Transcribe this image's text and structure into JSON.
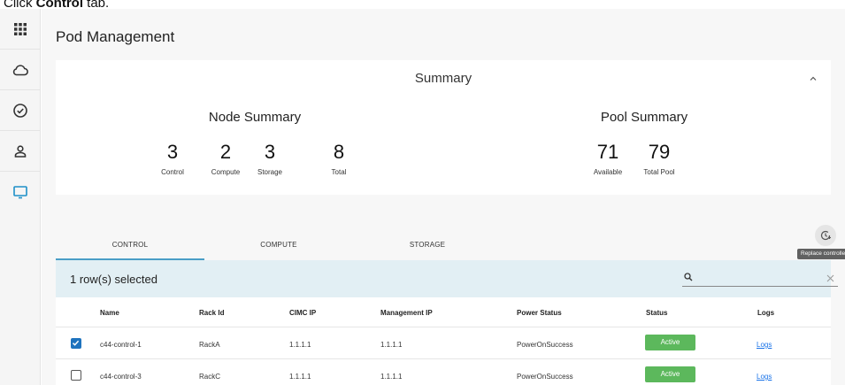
{
  "instruction": {
    "prefix": "Click ",
    "target": "Control",
    "suffix": " tab."
  },
  "sidebar": {
    "icons": [
      "grid-icon",
      "cloud-icon",
      "check-circle-icon",
      "user-icon",
      "monitor-icon"
    ]
  },
  "page_title": "Pod Management",
  "summary": {
    "title": "Summary",
    "node_summary": {
      "title": "Node Summary",
      "stats": [
        {
          "value": "3",
          "label": "Control"
        },
        {
          "value": "2",
          "label": "Compute"
        },
        {
          "value": "3",
          "label": "Storage"
        },
        {
          "value": "8",
          "label": "Total"
        }
      ]
    },
    "pool_summary": {
      "title": "Pool Summary",
      "stats": [
        {
          "value": "71",
          "label": "Available"
        },
        {
          "value": "79",
          "label": "Total Pool"
        }
      ]
    }
  },
  "tabs": [
    {
      "label": "CONTROL",
      "active": true
    },
    {
      "label": "COMPUTE",
      "active": false
    },
    {
      "label": "STORAGE",
      "active": false
    }
  ],
  "replace_tooltip": "Replace controller",
  "selection": {
    "text": "1 row(s) selected",
    "search_value": ""
  },
  "table": {
    "headers": [
      "Name",
      "Rack Id",
      "CIMC IP",
      "Management IP",
      "Power Status",
      "Status",
      "Logs"
    ],
    "rows": [
      {
        "checked": true,
        "name": "c44-control-1",
        "rack": "RackA",
        "cimc": "1.1.1.1",
        "mgmt": "1.1.1.1",
        "power": "PowerOnSuccess",
        "status": "Active",
        "logs": "Logs"
      },
      {
        "checked": false,
        "name": "c44-control-3",
        "rack": "RackC",
        "cimc": "1.1.1.1",
        "mgmt": "1.1.1.1",
        "power": "PowerOnSuccess",
        "status": "Active",
        "logs": "Logs"
      }
    ]
  },
  "colors": {
    "accent": "#4a9ec7",
    "status_active": "#5cb85c",
    "selection_bar": "#e2eff4",
    "link": "#1a73e8"
  }
}
